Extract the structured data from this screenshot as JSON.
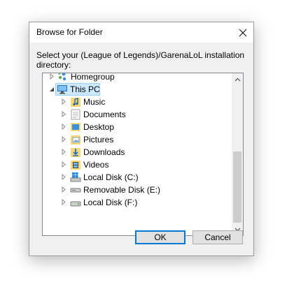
{
  "dialog": {
    "title": "Browse for Folder",
    "prompt": "Select your (League of Legends)/GarenaLoL installation directory:"
  },
  "tree": {
    "items": [
      {
        "label": "Homegroup",
        "icon": "homegroup-icon",
        "expander": "collapsed"
      },
      {
        "label": "This PC",
        "icon": "computer-icon",
        "expander": "expanded",
        "selected": true
      },
      {
        "label": "Music",
        "icon": "music-folder-icon",
        "expander": "collapsed"
      },
      {
        "label": "Documents",
        "icon": "documents-folder-icon",
        "expander": "collapsed"
      },
      {
        "label": "Desktop",
        "icon": "desktop-folder-icon",
        "expander": "collapsed"
      },
      {
        "label": "Pictures",
        "icon": "pictures-folder-icon",
        "expander": "collapsed"
      },
      {
        "label": "Downloads",
        "icon": "downloads-folder-icon",
        "expander": "collapsed"
      },
      {
        "label": "Videos",
        "icon": "videos-folder-icon",
        "expander": "collapsed"
      },
      {
        "label": "Local Disk (C:)",
        "icon": "windows-drive-icon",
        "expander": "collapsed"
      },
      {
        "label": "Removable Disk (E:)",
        "icon": "removable-drive-icon",
        "expander": "collapsed"
      },
      {
        "label": "Local Disk (F:)",
        "icon": "drive-icon",
        "expander": "collapsed"
      }
    ]
  },
  "buttons": {
    "ok_label": "OK",
    "cancel_label": "Cancel"
  },
  "colors": {
    "selection": "#cce8ff",
    "selection_border": "#99d1ff",
    "folder": "#f8d775",
    "default_button_border": "#0078d7"
  }
}
